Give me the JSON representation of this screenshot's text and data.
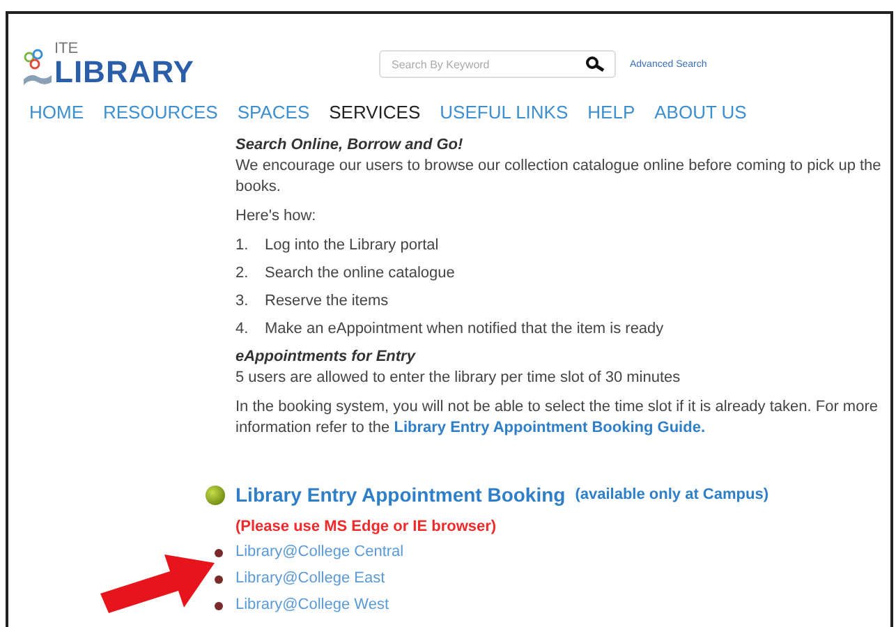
{
  "logo": {
    "small_text": "ITE",
    "large_text": "LIBRARY"
  },
  "search": {
    "placeholder": "Search By Keyword"
  },
  "advanced_search": "Advanced Search",
  "nav": [
    {
      "label": "HOME",
      "selected": false
    },
    {
      "label": "RESOURCES",
      "selected": false
    },
    {
      "label": "SPACES",
      "selected": false
    },
    {
      "label": "SERVICES",
      "selected": true
    },
    {
      "label": "USEFUL LINKS",
      "selected": false
    },
    {
      "label": "HELP",
      "selected": false
    },
    {
      "label": "ABOUT US",
      "selected": false
    }
  ],
  "intro": {
    "heading": "Search Online, Borrow and Go!",
    "text": "We encourage our users to browse our collection catalogue online before coming to pick up the books.",
    "how": "Here's how:"
  },
  "steps": [
    {
      "number": "1.",
      "text": "Log into the Library portal"
    },
    {
      "number": "2.",
      "text": "Search the online catalogue"
    },
    {
      "number": "3.",
      "text": "Reserve the items"
    },
    {
      "number": "4.",
      "text": "Make an eAppointment when notified that the item is ready"
    }
  ],
  "entry": {
    "heading": "eAppointments for Entry",
    "text": "5 users are allowed to enter the library per time slot of 30 minutes",
    "booking_text": "In the booking system, you will not be able to select the time slot if it is already taken. For more information refer to the",
    "guide_link": "Library Entry Appointment Booking Guide."
  },
  "booking": {
    "title": "Library Entry Appointment Booking",
    "note": "(available only at Campus)",
    "warning": "(Please use MS Edge or IE browser)",
    "links": [
      "Library@College Central",
      "Library@College East",
      "Library@College West"
    ]
  }
}
